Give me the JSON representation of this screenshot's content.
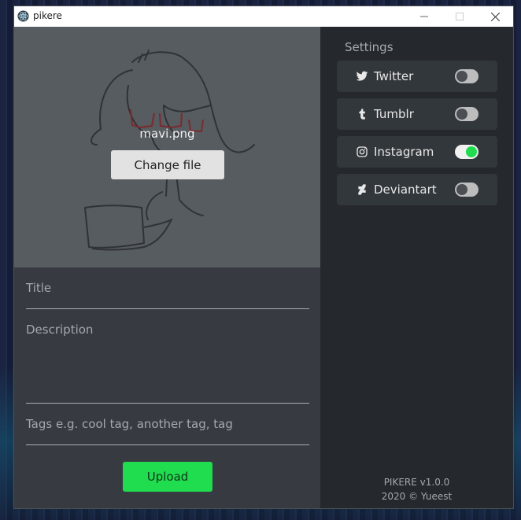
{
  "window": {
    "title": "pikere"
  },
  "upload_form": {
    "filename": "mavi.png",
    "change_file_label": "Change file",
    "title_placeholder": "Title",
    "description_placeholder": "Description",
    "tags_placeholder": "Tags e.g. cool tag, another tag, tag",
    "upload_label": "Upload"
  },
  "settings": {
    "heading": "Settings",
    "services": [
      {
        "label": "Twitter",
        "icon": "twitter-icon",
        "enabled": false
      },
      {
        "label": "Tumblr",
        "icon": "tumblr-icon",
        "enabled": false
      },
      {
        "label": "Instagram",
        "icon": "instagram-icon",
        "enabled": true
      },
      {
        "label": "Deviantart",
        "icon": "deviantart-icon",
        "enabled": false
      }
    ]
  },
  "footer": {
    "version": "PIKERE v1.0.0",
    "copyright": "2020 © Yueest"
  },
  "colors": {
    "accent": "#1fdd4e",
    "panel": "#25292e",
    "form": "#373b41",
    "preview": "#575c61"
  }
}
